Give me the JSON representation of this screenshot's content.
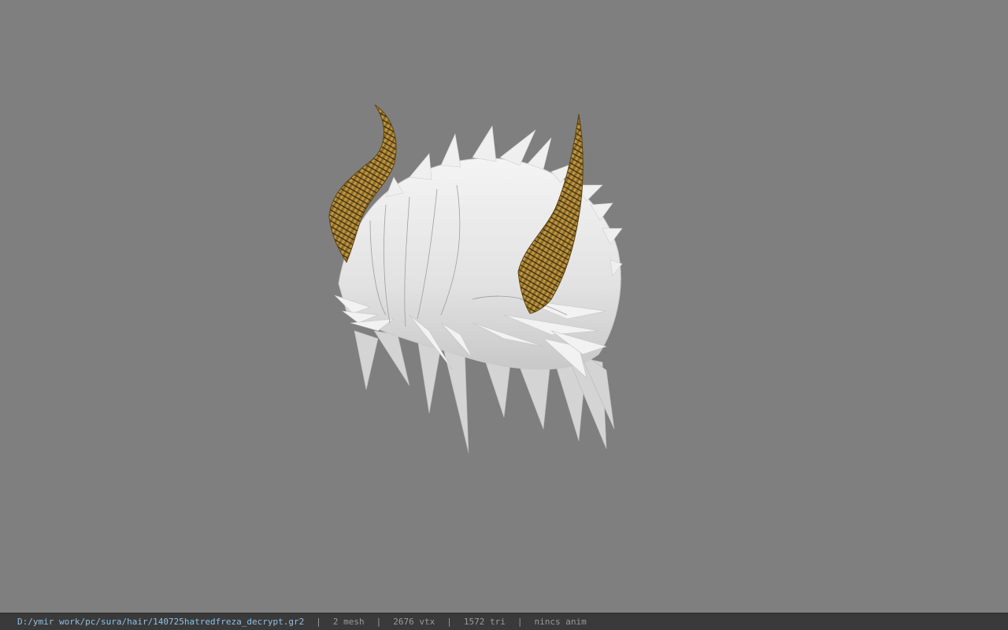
{
  "viewer": {
    "background_color": "#7f7f7f",
    "model": {
      "hair_color": "#eeeeee",
      "horn_color": "#b08a3a"
    }
  },
  "status": {
    "path": "D:/ymir work/pc/sura/hair/140725hatredfreza_decrypt.gr2",
    "separator": "|",
    "mesh": "2 mesh",
    "vertices": "2676 vtx",
    "triangles": "1572 tri",
    "anim": "nincs anim"
  }
}
